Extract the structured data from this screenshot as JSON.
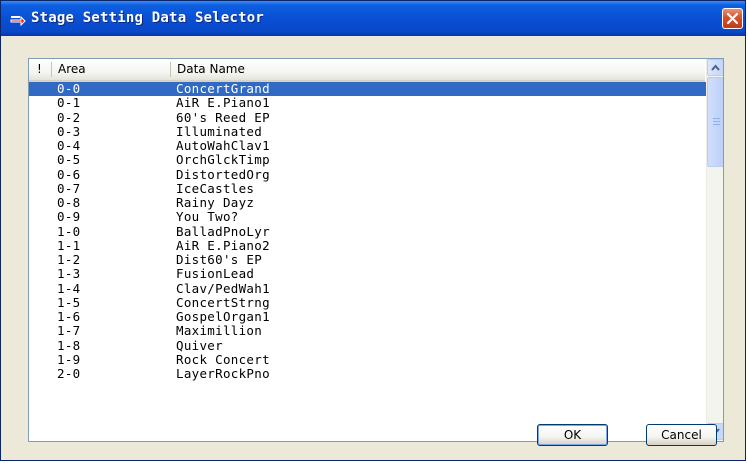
{
  "window": {
    "title": "Stage Setting Data Selector"
  },
  "list": {
    "columns": [
      {
        "label": "!"
      },
      {
        "label": "Area"
      },
      {
        "label": "Data Name"
      }
    ],
    "selected_index": 0,
    "rows": [
      {
        "area": "0-0",
        "name": "ConcertGrand"
      },
      {
        "area": "0-1",
        "name": "AiR E.Piano1"
      },
      {
        "area": "0-2",
        "name": "60's Reed EP"
      },
      {
        "area": "0-3",
        "name": "Illuminated"
      },
      {
        "area": "0-4",
        "name": "AutoWahClav1"
      },
      {
        "area": "0-5",
        "name": "OrchGlckTimp"
      },
      {
        "area": "0-6",
        "name": "DistortedOrg"
      },
      {
        "area": "0-7",
        "name": "IceCastles"
      },
      {
        "area": "0-8",
        "name": "Rainy Dayz"
      },
      {
        "area": "0-9",
        "name": "You Two?"
      },
      {
        "area": "1-0",
        "name": "BalladPnoLyr"
      },
      {
        "area": "1-1",
        "name": "AiR E.Piano2"
      },
      {
        "area": "1-2",
        "name": "Dist60's EP"
      },
      {
        "area": "1-3",
        "name": "FusionLead"
      },
      {
        "area": "1-4",
        "name": "Clav/PedWah1"
      },
      {
        "area": "1-5",
        "name": "ConcertStrng"
      },
      {
        "area": "1-6",
        "name": "GospelOrgan1"
      },
      {
        "area": "1-7",
        "name": "Maximillion"
      },
      {
        "area": "1-8",
        "name": "Quiver"
      },
      {
        "area": "1-9",
        "name": "Rock Concert"
      },
      {
        "area": "2-0",
        "name": "LayerRockPno"
      }
    ]
  },
  "buttons": {
    "ok": "OK",
    "cancel": "Cancel"
  },
  "icons": {
    "title": "window-arrow-icon",
    "close": "close-icon",
    "scroll_up": "scroll-up-arrow-icon",
    "scroll_down": "scroll-down-arrow-icon"
  },
  "colors": {
    "titlebar": "#0a4fd4",
    "selection": "#316ac5",
    "close_button": "#d2502e",
    "face": "#ece9d8"
  }
}
